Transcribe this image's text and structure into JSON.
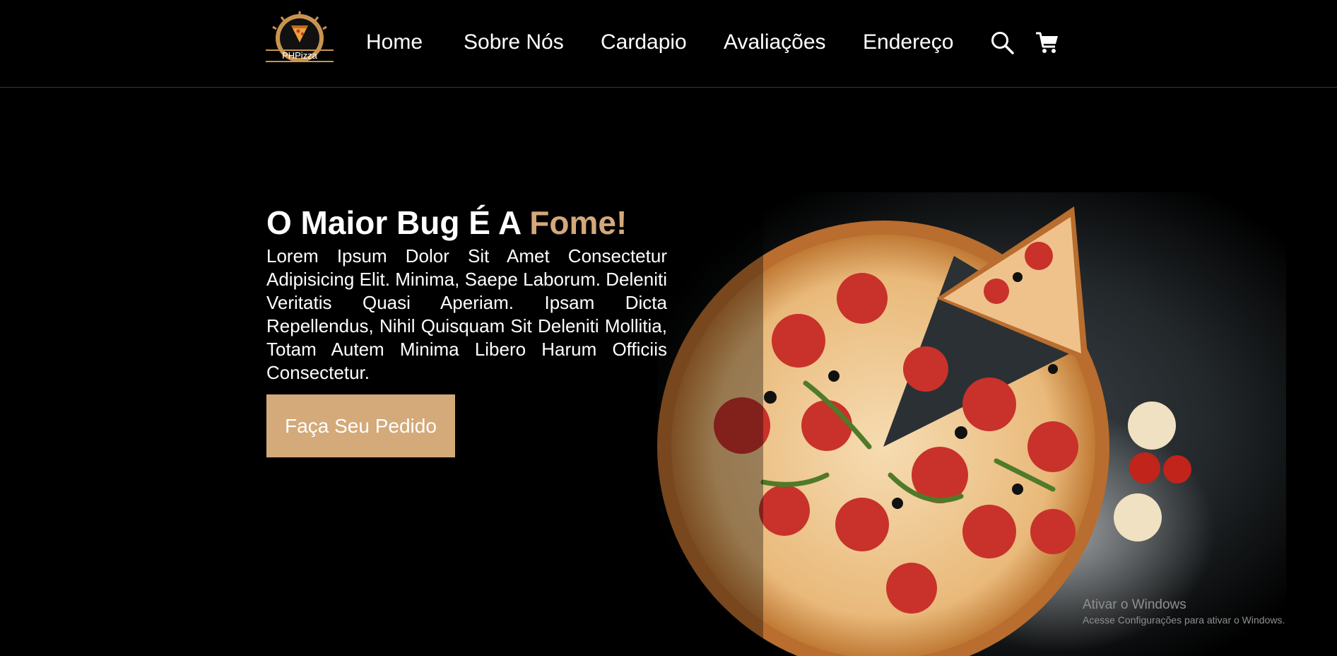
{
  "brand": {
    "logo_text": "PHPizza",
    "logo_icon": "pizza-slice-icon"
  },
  "nav": {
    "items": [
      {
        "label": "Home"
      },
      {
        "label": "Sobre Nós"
      },
      {
        "label": "Cardapio"
      },
      {
        "label": "Avaliações"
      },
      {
        "label": "Endereço"
      }
    ],
    "search_icon": "search-icon",
    "cart_icon": "cart-icon"
  },
  "hero": {
    "title_main": "O Maior Bug É A ",
    "title_accent": "Fome!",
    "description": "Lorem Ipsum Dolor Sit Amet Consectetur Adipisicing Elit. Minima, Saepe Laborum. Deleniti Veritatis Quasi Aperiam. Ipsam Dicta Repellendus, Nihil Quisquam Sit Deleniti Mollitia, Totam Autem Minima Libero Harum Officiis Consectetur.",
    "cta_label": "Faça Seu Pedido"
  },
  "watermark": {
    "title": "Ativar o Windows",
    "subtitle": "Acesse Configurações para ativar o Windows."
  },
  "colors": {
    "accent": "#d4a87a",
    "background": "#000000",
    "button": "#d4aa7a"
  }
}
